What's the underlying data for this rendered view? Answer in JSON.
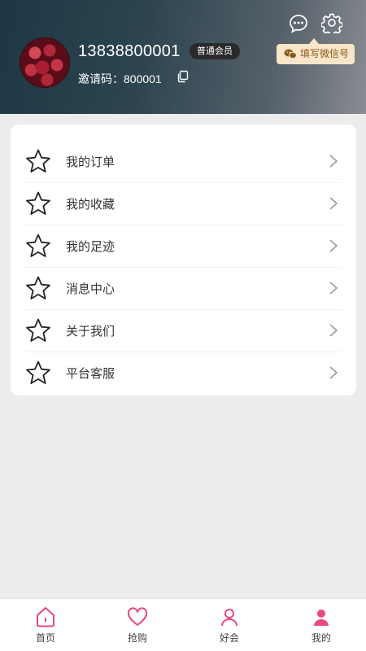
{
  "user": {
    "phone": "13838800001",
    "member_badge": "普通会员",
    "invite_code": "邀请码：800001"
  },
  "header": {
    "wechat_label": "填写微信号"
  },
  "menu": {
    "items": [
      {
        "label": "我的订单",
        "icon": "star-icon"
      },
      {
        "label": "我的收藏",
        "icon": "star-icon"
      },
      {
        "label": "我的足迹",
        "icon": "star-icon"
      },
      {
        "label": "消息中心",
        "icon": "star-icon"
      },
      {
        "label": "关于我们",
        "icon": "star-icon"
      },
      {
        "label": "平台客服",
        "icon": "star-icon"
      }
    ]
  },
  "tabs": [
    {
      "label": "首页",
      "icon": "home-icon"
    },
    {
      "label": "抢购",
      "icon": "heart-icon"
    },
    {
      "label": "好会",
      "icon": "member-icon"
    },
    {
      "label": "我的",
      "icon": "person-icon"
    }
  ],
  "colors": {
    "accent": "#e84a7a",
    "badge_bg": "#f7e6c9",
    "badge_text": "#8c5a1f"
  }
}
